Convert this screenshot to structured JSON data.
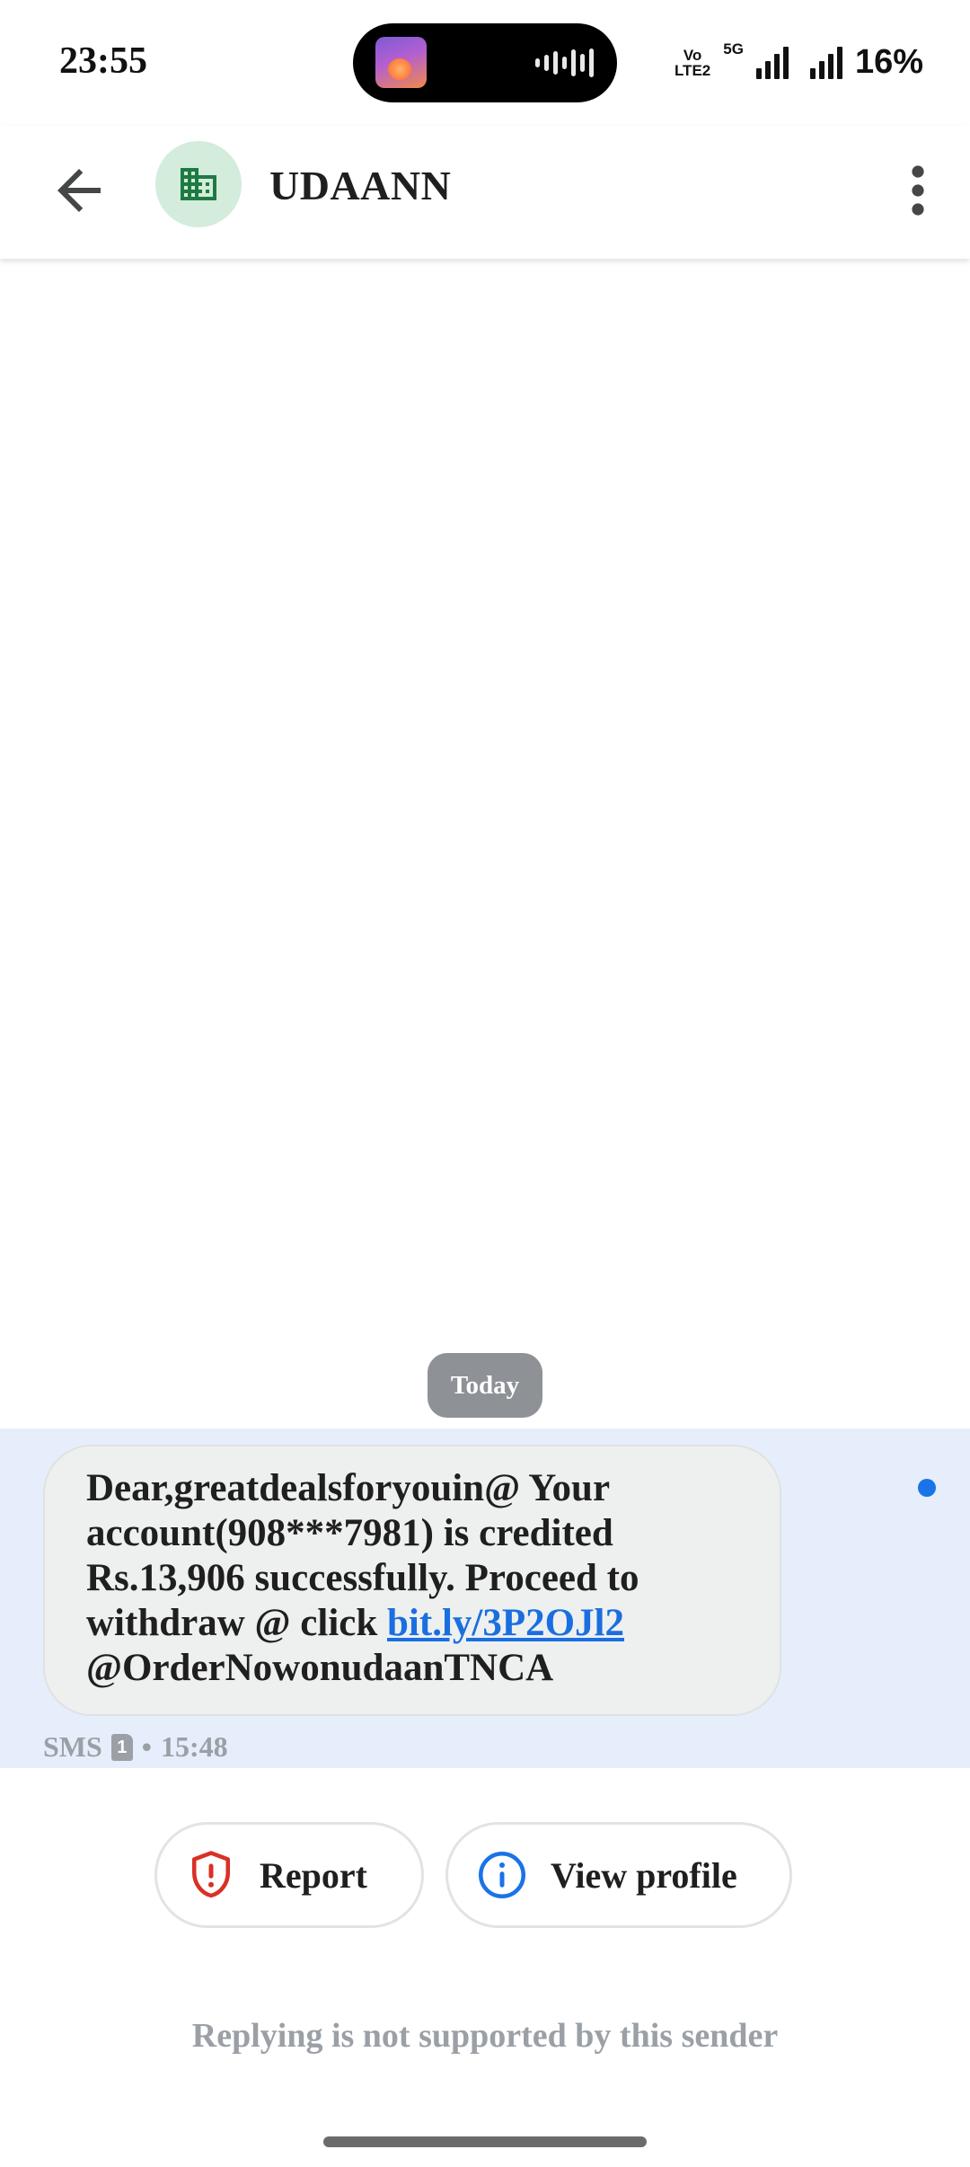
{
  "status_bar": {
    "time": "23:55",
    "network_vo": "Vo",
    "network_lte": "LTE2",
    "network_5g": "5G",
    "battery": "16%"
  },
  "header": {
    "contact_name": "UDAANN",
    "avatar_icon": "building-icon",
    "avatar_bg": "#d3ecdc",
    "avatar_fg": "#1e7a43"
  },
  "conversation": {
    "date_chip": "Today",
    "message": {
      "text_before_link": "Dear,greatdealsforyouin@ Your account(908***7981) is credited Rs.13,906 successfully. Proceed to withdraw @ click ",
      "link": "bit.ly/3P2OJl2",
      "text_after_link": "@OrderNowonudaanTNCA",
      "channel": "SMS",
      "sim": "1",
      "separator": "•",
      "time": "15:48",
      "unread": true
    }
  },
  "actions": {
    "report_label": "Report",
    "view_profile_label": "View profile"
  },
  "footer": {
    "no_reply_text": "Replying is not supported by this sender"
  },
  "colors": {
    "highlight": "#e6eefb",
    "link": "#1a6fe0",
    "report_icon": "#d93025",
    "info_icon": "#1a73e8"
  }
}
